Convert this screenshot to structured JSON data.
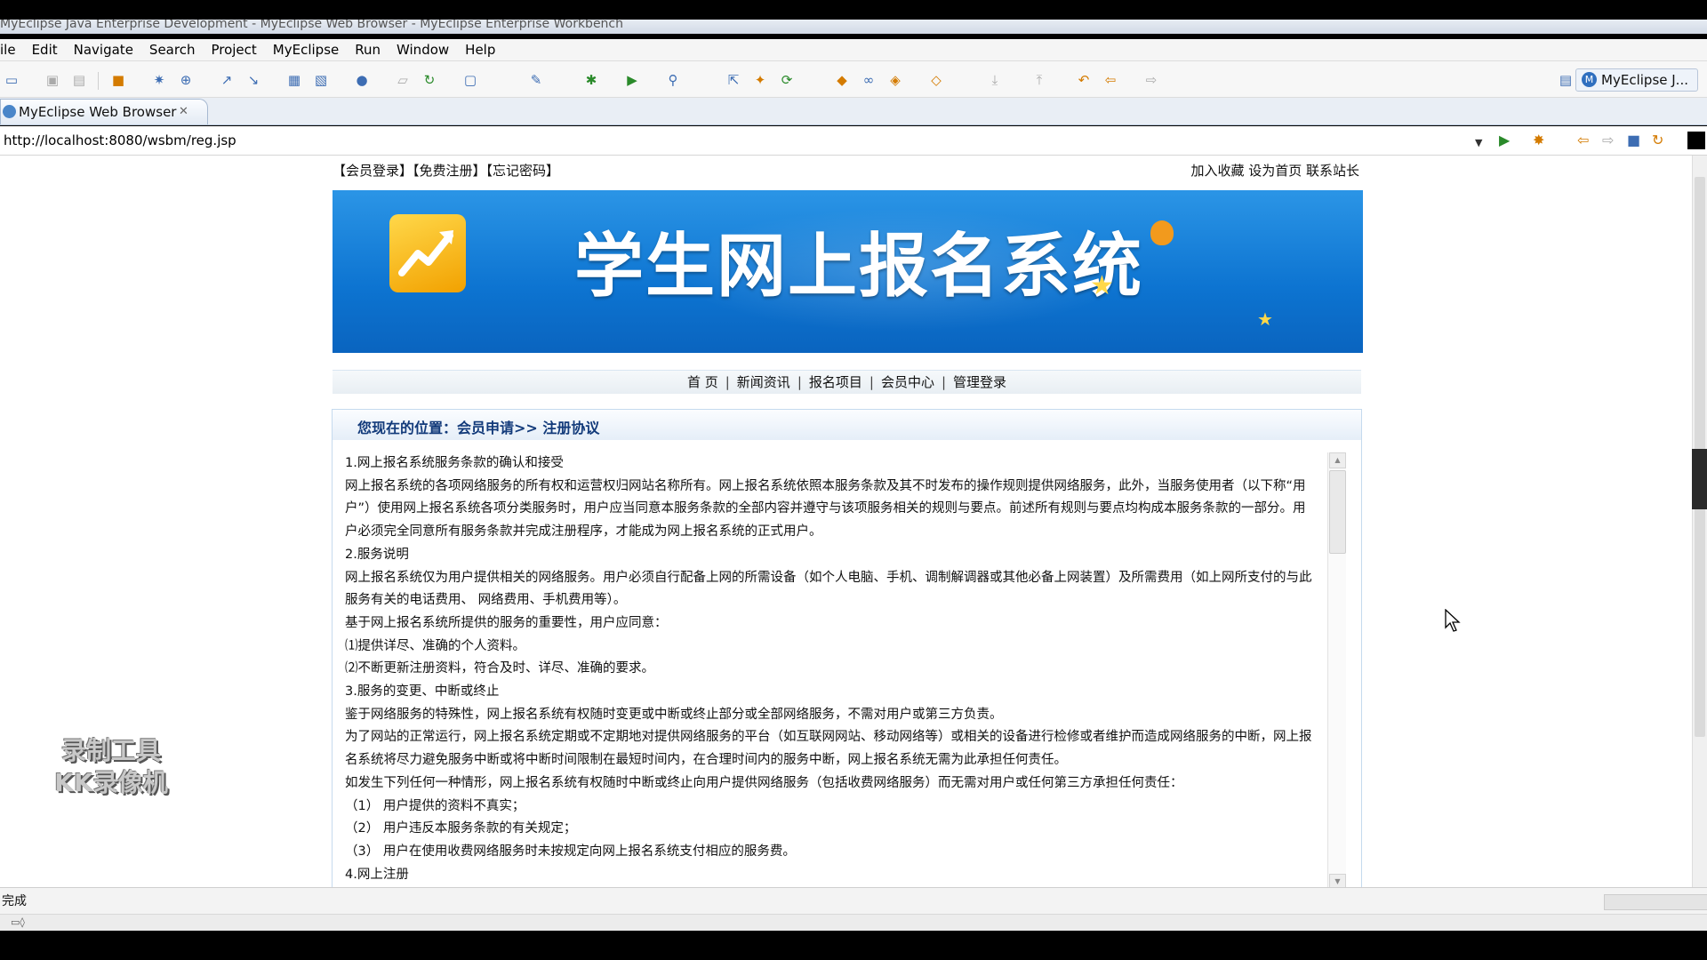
{
  "window": {
    "title": "MyEclipse Java Enterprise Development - MyEclipse Web Browser - MyEclipse Enterprise Workbench"
  },
  "menu": [
    "ile",
    "Edit",
    "Navigate",
    "Search",
    "Project",
    "MyEclipse",
    "Run",
    "Window",
    "Help"
  ],
  "perspective": {
    "label": "MyEclipse J..."
  },
  "editor_tab": {
    "label": "MyEclipse Web Browser",
    "close_glyph": "✕"
  },
  "browser": {
    "url": "http://localhost:8080/wsbm/reg.jsp"
  },
  "page": {
    "top_left_links": "【会员登录】【免费注册】【忘记密码】",
    "top_right_links": "加入收藏  设为首页  联系站长",
    "banner_title": "学生网上报名系统",
    "nav": [
      "首 页",
      "新闻资讯",
      "报名项目",
      "会员中心",
      "管理登录"
    ],
    "location": "您现在的位置：会员申请>> 注册协议",
    "agreement_lines": [
      "1.网上报名系统服务条款的确认和接受",
      "网上报名系统的各项网络服务的所有权和运营权归网站名称所有。网上报名系统依照本服务条款及其不时发布的操作规则提供网络服务，此外，当服务使用者（以下称“用",
      "户”）使用网上报名系统各项分类服务时，用户应当同意本服务条款的全部内容并遵守与该项服务相关的规则与要点。前述所有规则与要点均构成本服务条款的一部分。用",
      "户必须完全同意所有服务条款并完成注册程序，才能成为网上报名系统的正式用户。",
      "2.服务说明",
      "网上报名系统仅为用户提供相关的网络服务。用户必须自行配备上网的所需设备（如个人电脑、手机、调制解调器或其他必备上网装置）及所需费用（如上网所支付的与此",
      "服务有关的电话费用、 网络费用、手机费用等）。",
      "基于网上报名系统所提供的服务的重要性，用户应同意：",
      "⑴提供详尽、准确的个人资料。",
      "⑵不断更新注册资料，符合及时、详尽、准确的要求。",
      "3.服务的变更、中断或终止",
      "鉴于网络服务的特殊性，网上报名系统有权随时变更或中断或终止部分或全部网络服务，不需对用户或第三方负责。",
      "为了网站的正常运行，网上报名系统定期或不定期地对提供网络服务的平台（如互联网网站、移动网络等）或相关的设备进行检修或者维护而造成网络服务的中断，网上报",
      "名系统将尽力避免服务中断或将中断时间限制在最短时间内，在合理时间内的服务中断，网上报名系统无需为此承担任何责任。",
      "如发生下列任何一种情形，网上报名系统有权随时中断或终止向用户提供网络服务（包括收费网络服务）而无需对用户或任何第三方承担任何责任：",
      "（1） 用户提供的资料不真实；",
      "（2） 用户违反本服务条款的有关规定；",
      "（3） 用户在使用收费网络服务时未按规定向网上报名系统支付相应的服务费。",
      "4.网上注册"
    ]
  },
  "watermark": [
    "录制工具",
    "KK录像机"
  ],
  "status": {
    "text": "完成"
  },
  "colors": {
    "banner_blue": "#1583db",
    "location_text": "#123a7a",
    "toolbar_bg": "#f7f7f7"
  },
  "icons": [
    "new-file-icon",
    "save-icon",
    "print-icon",
    "debug-icon",
    "run-icon",
    "external-tools-icon",
    "search-icon",
    "back-icon",
    "forward-icon",
    "go-icon",
    "refresh-icon",
    "stop-icon",
    "home-icon",
    "perspective-icon",
    "browser-tab-icon",
    "cursor-icon"
  ]
}
